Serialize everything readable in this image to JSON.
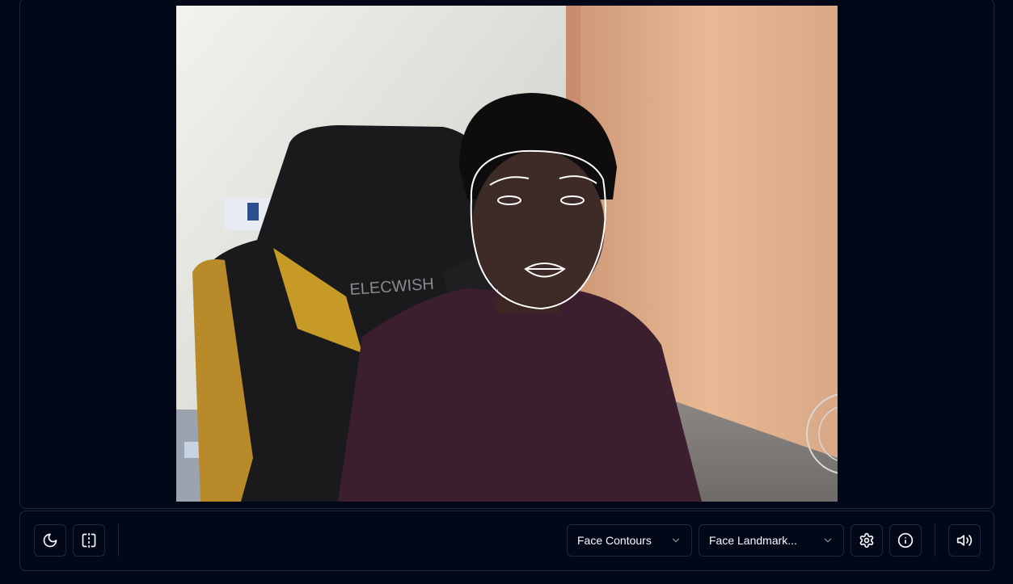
{
  "video": {
    "chair_brand_text": "ELECWISH",
    "overlay_color": "#ffffff"
  },
  "toolbar": {
    "left_buttons": [
      {
        "icon": "moon-icon",
        "name": "theme-toggle-button"
      },
      {
        "icon": "mirror-flip-icon",
        "name": "mirror-toggle-button"
      }
    ],
    "mode_select": {
      "value": "Face Contours"
    },
    "model_select": {
      "value": "Face Landmark..."
    },
    "right_buttons": [
      {
        "icon": "gear-icon",
        "name": "settings-button"
      },
      {
        "icon": "info-icon",
        "name": "info-button"
      },
      {
        "icon": "volume-icon",
        "name": "sound-toggle-button"
      }
    ]
  },
  "colors": {
    "background": "#020817",
    "border": "#1e293b",
    "text": "#f8fafc"
  }
}
